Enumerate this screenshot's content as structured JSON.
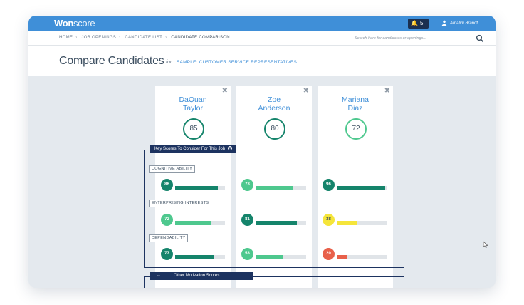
{
  "app": {
    "logo_bold": "Won",
    "logo_thin": "score",
    "notifications_count": "5",
    "user_name": "Amalini Brandt"
  },
  "breadcrumb": [
    "HOME",
    "JOB OPENINGS",
    "CANDIDATE LIST",
    "CANDIDATE COMPARISON"
  ],
  "search": {
    "placeholder": "Search here for candidates or openings..."
  },
  "page": {
    "title": "Compare Candidates",
    "for_word": "for",
    "job": "SAMPLE: CUSTOMER SERVICE REPRESENTATIVES"
  },
  "candidates": [
    {
      "first": "DaQuan",
      "last": "Taylor",
      "score": "85",
      "close": "✖"
    },
    {
      "first": "Zoe",
      "last": "Anderson",
      "score": "80",
      "close": "✖"
    },
    {
      "first": "Mariana",
      "last": "Diaz",
      "score": "72",
      "close": "✖"
    }
  ],
  "key_scores": {
    "title": "Key Scores To Consider For This Job",
    "help_icon": "?",
    "categories": [
      {
        "label": "COGNITIVE ABILITY",
        "values": [
          "86",
          "73",
          "96"
        ],
        "fractions": [
          0.86,
          0.73,
          0.96
        ]
      },
      {
        "label": "ENTERPRISING INTERESTS",
        "values": [
          "72",
          "81",
          "38"
        ],
        "fractions": [
          0.72,
          0.81,
          0.38
        ]
      },
      {
        "label": "DEPENDABILITY",
        "values": [
          "77",
          "53",
          "20"
        ],
        "fractions": [
          0.77,
          0.53,
          0.2
        ]
      }
    ]
  },
  "other_scores": {
    "title": "Other Motivation Scores",
    "chevron": "⌄"
  },
  "colors": {
    "dark_green": "#15846b",
    "light_green": "#4ec88e",
    "yellow": "#f5e53a",
    "red": "#e8604a",
    "brand_blue": "#3f8fd8",
    "navy": "#1d3360"
  }
}
